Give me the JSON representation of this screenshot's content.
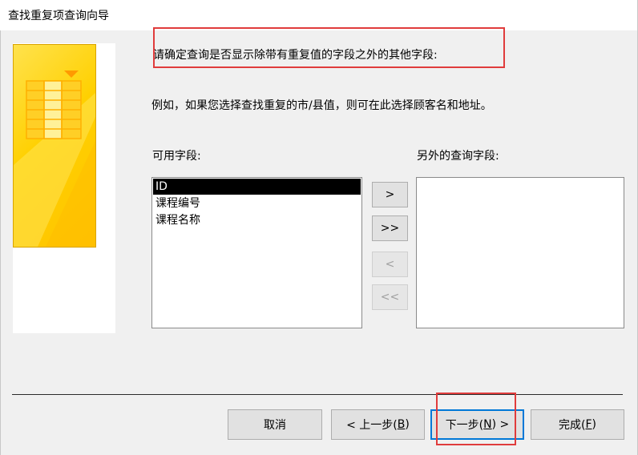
{
  "window": {
    "title": "查找重复项查询向导"
  },
  "instructions": {
    "prompt": "请确定查询是否显示除带有重复值的字段之外的其他字段:",
    "example": "例如，如果您选择查找重复的市/县值，则可在此选择顾客名和地址。"
  },
  "available_fields": {
    "label": "可用字段:",
    "items": [
      "ID",
      "课程编号",
      "课程名称"
    ],
    "selected_index": 0
  },
  "extra_fields": {
    "label": "另外的查询字段:",
    "items": []
  },
  "move_buttons": {
    "add_one": ">",
    "add_all": ">>",
    "remove_one": "<",
    "remove_all": "<<"
  },
  "footer_buttons": {
    "cancel": "取消",
    "back_prefix": "< 上一步(",
    "back_key": "B",
    "back_suffix": ")",
    "next_prefix": "下一步(",
    "next_key": "N",
    "next_suffix": ") >",
    "finish_prefix": "完成(",
    "finish_key": "F",
    "finish_suffix": ")"
  },
  "colors": {
    "annotation_red": "#e03c3c",
    "default_button_blue": "#0078d7",
    "wizard_art_yellow": "#ffd000"
  }
}
